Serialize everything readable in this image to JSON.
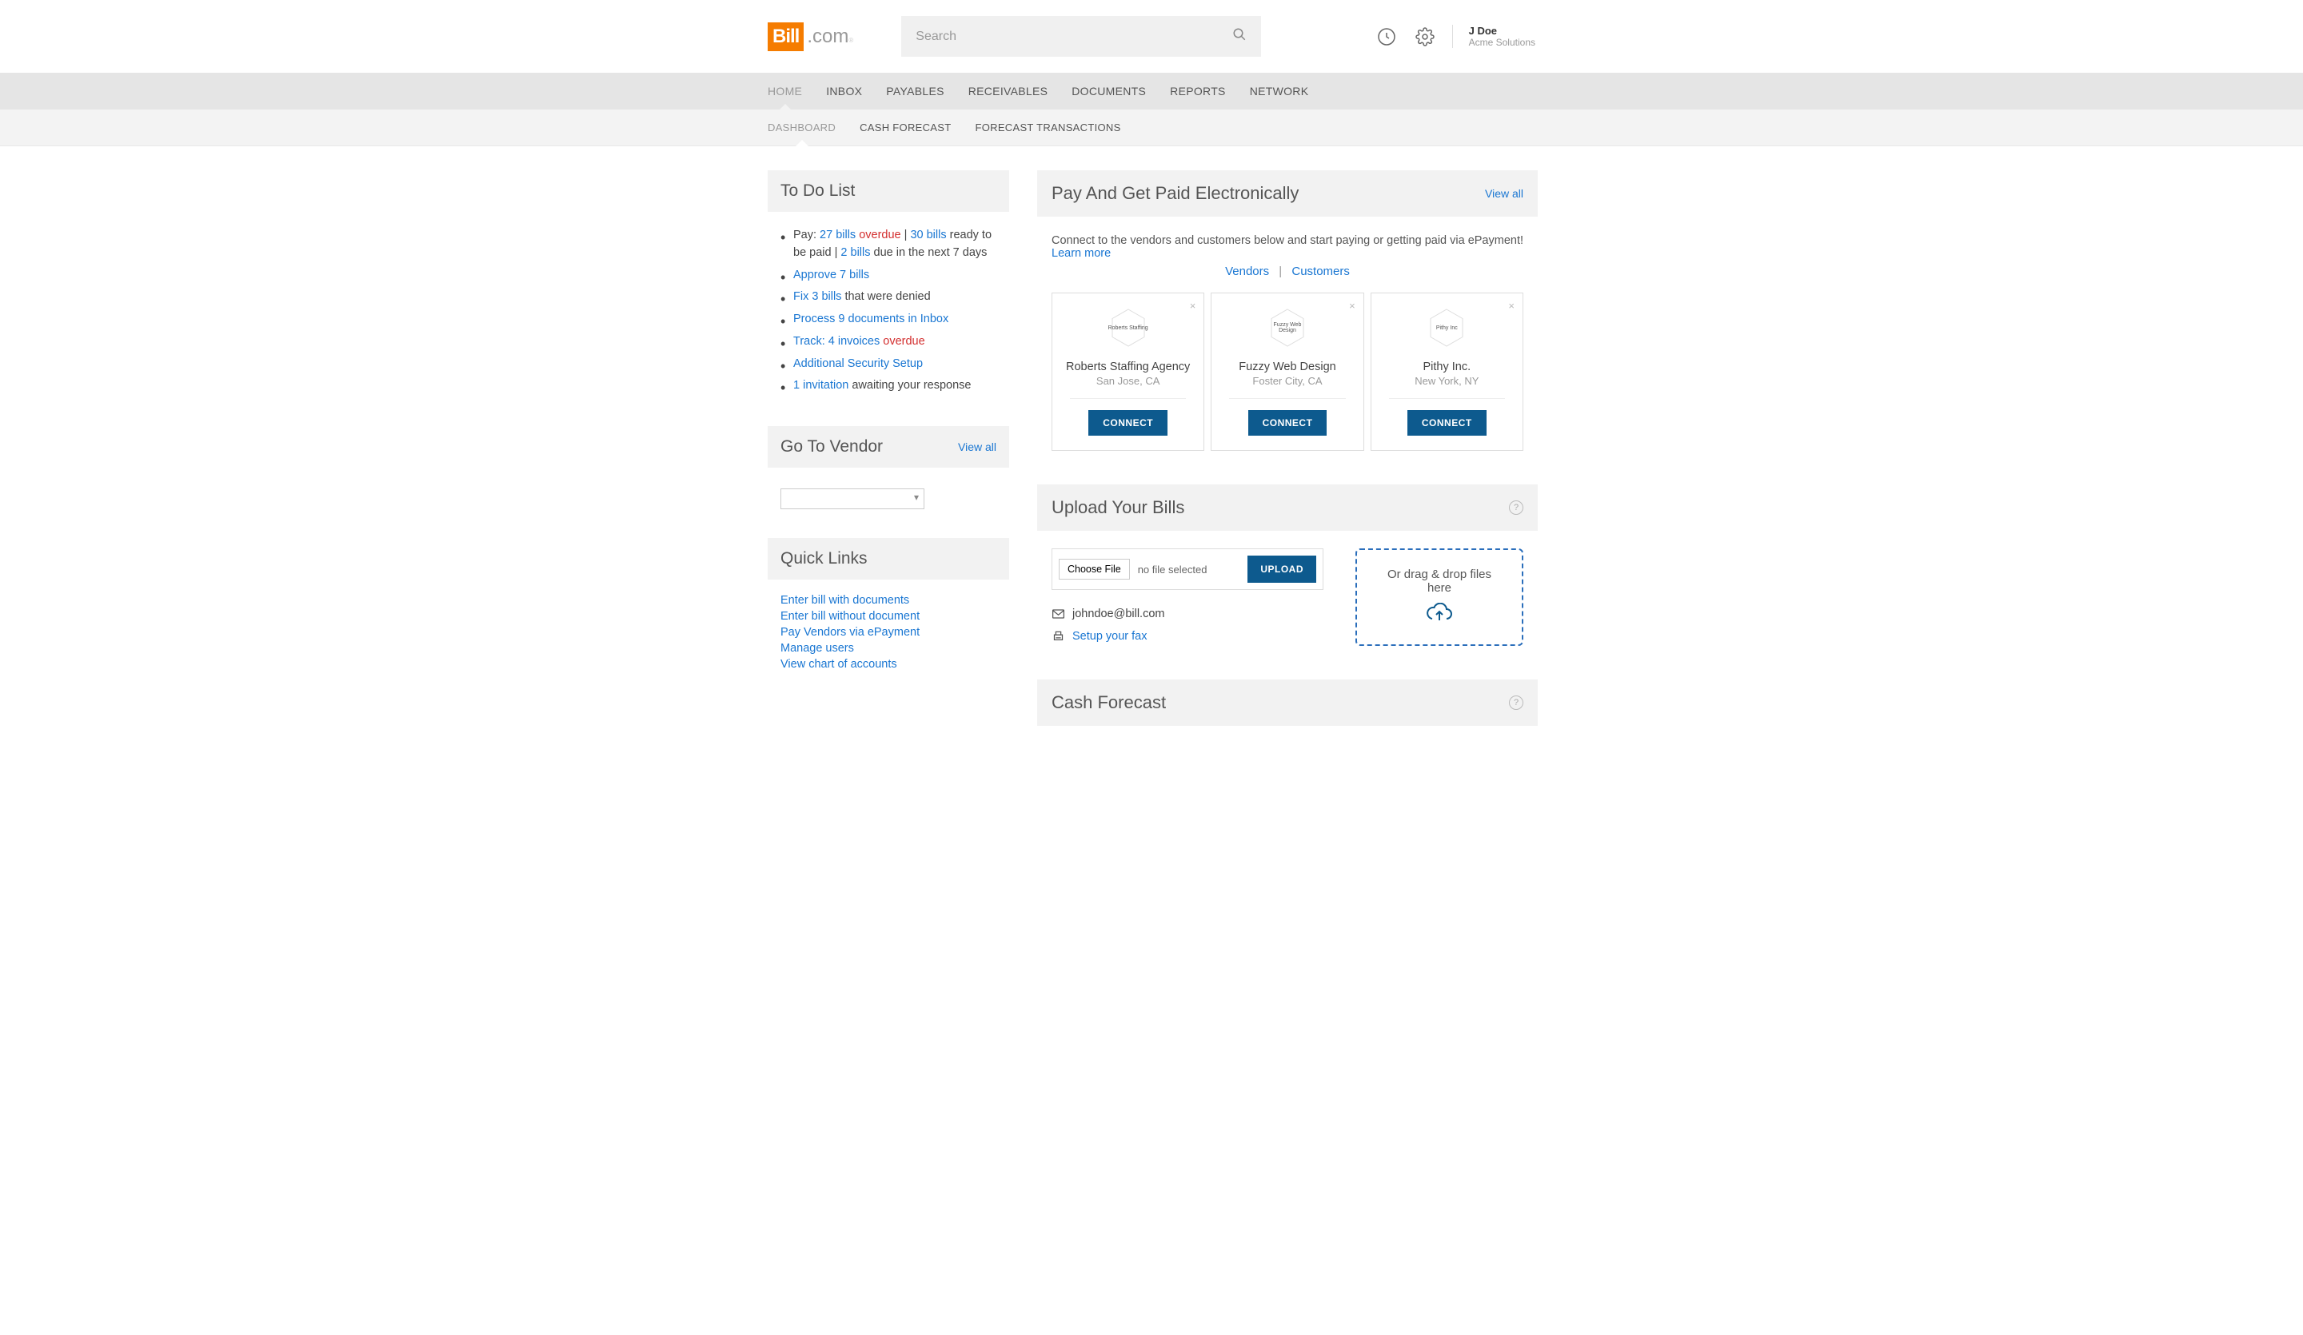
{
  "header": {
    "logo_box": "Bill",
    "logo_com": ".com",
    "search_placeholder": "Search",
    "user_name": "J Doe",
    "user_org": "Acme Solutions"
  },
  "nav_primary": [
    "HOME",
    "INBOX",
    "PAYABLES",
    "RECEIVABLES",
    "DOCUMENTS",
    "REPORTS",
    "NETWORK"
  ],
  "nav_secondary": [
    "DASHBOARD",
    "CASH FORECAST",
    "FORECAST TRANSACTIONS"
  ],
  "todo": {
    "title": "To Do List",
    "items": {
      "pay_prefix": "Pay: ",
      "pay_27": "27 bills",
      "pay_overdue": " overdue",
      "pay_sep": " | ",
      "pay_30": "30 bills",
      "pay_ready": " ready to be paid | ",
      "pay_2": "2 bills",
      "pay_due": " due in the next 7 days",
      "approve": "Approve 7 bills",
      "fix_link": "Fix 3 bills",
      "fix_rest": " that were denied",
      "process": "Process 9 documents in Inbox",
      "track_link": "Track: 4 invoices",
      "track_overdue": " overdue",
      "security": "Additional Security Setup",
      "invite_link": "1 invitation",
      "invite_rest": " awaiting your response"
    }
  },
  "goto_vendor": {
    "title": "Go To Vendor",
    "view_all": "View all"
  },
  "quick_links": {
    "title": "Quick Links",
    "items": [
      "Enter bill with documents",
      "Enter bill without document",
      "Pay Vendors via ePayment",
      "Manage users",
      "View chart of accounts"
    ]
  },
  "pay_panel": {
    "title": "Pay And Get Paid Electronically",
    "view_all": "View all",
    "intro_text": "Connect to the vendors and customers below and start paying or getting paid via ePayment! ",
    "learn_more": "Learn more",
    "vendors_label": "Vendors",
    "customers_label": "Customers",
    "cards": [
      {
        "name": "Roberts Staffing Agency",
        "loc": "San Jose, CA",
        "icon_text": "Roberts Staffing"
      },
      {
        "name": "Fuzzy Web Design",
        "loc": "Foster City, CA",
        "icon_text": "Fuzzy Web Design"
      },
      {
        "name": "Pithy Inc.",
        "loc": "New York, NY",
        "icon_text": "Pithy Inc"
      }
    ],
    "connect_label": "CONNECT"
  },
  "upload_panel": {
    "title": "Upload Your Bills",
    "choose_file": "Choose File",
    "no_file": "no file selected",
    "upload_btn": "UPLOAD",
    "email": "johndoe@bill.com",
    "fax_link": "Setup your fax",
    "dropzone_text": "Or drag & drop files here"
  },
  "cash_panel": {
    "title": "Cash Forecast"
  }
}
